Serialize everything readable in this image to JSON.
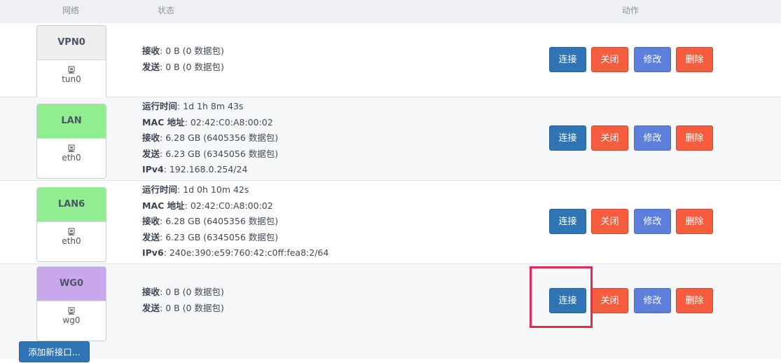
{
  "header": {
    "network": "网络",
    "status": "状态",
    "actions": "动作"
  },
  "buttons": {
    "connect": "连接",
    "stop": "关闭",
    "edit": "修改",
    "delete": "删除"
  },
  "add_interface": "添加新接口...",
  "interfaces": [
    {
      "name": "VPN0",
      "device": "tun0",
      "name_bg": "#eeeeee",
      "status": [
        {
          "label": "接收",
          "value": ": 0 B (0 数据包)"
        },
        {
          "label": "发送",
          "value": ": 0 B (0 数据包)"
        }
      ]
    },
    {
      "name": "LAN",
      "device": "eth0",
      "name_bg": "#90ee90",
      "status": [
        {
          "label": "运行时间",
          "value": ": 1d 1h 8m 43s"
        },
        {
          "label": "MAC 地址",
          "value": ": 02:42:C0:A8:00:02"
        },
        {
          "label": "接收",
          "value": ": 6.28 GB (6405356 数据包)"
        },
        {
          "label": "发送",
          "value": ": 6.23 GB (6345056 数据包)"
        },
        {
          "label": "IPv4",
          "value": ": 192.168.0.254/24"
        }
      ]
    },
    {
      "name": "LAN6",
      "device": "eth0",
      "name_bg": "#90ee90",
      "status": [
        {
          "label": "运行时间",
          "value": ": 1d 0h 10m 42s"
        },
        {
          "label": "MAC 地址",
          "value": ": 02:42:C0:A8:00:02"
        },
        {
          "label": "接收",
          "value": ": 6.28 GB (6405356 数据包)"
        },
        {
          "label": "发送",
          "value": ": 6.23 GB (6345056 数据包)"
        },
        {
          "label": "IPv6",
          "value": ": 240e:390:e59:760:42:c0ff:fea8:2/64"
        }
      ]
    },
    {
      "name": "WG0",
      "device": "wg0",
      "name_bg": "#c8a8ea",
      "status": [
        {
          "label": "接收",
          "value": ": 0 B (0 数据包)"
        },
        {
          "label": "发送",
          "value": ": 0 B (0 数据包)"
        }
      ]
    }
  ]
}
